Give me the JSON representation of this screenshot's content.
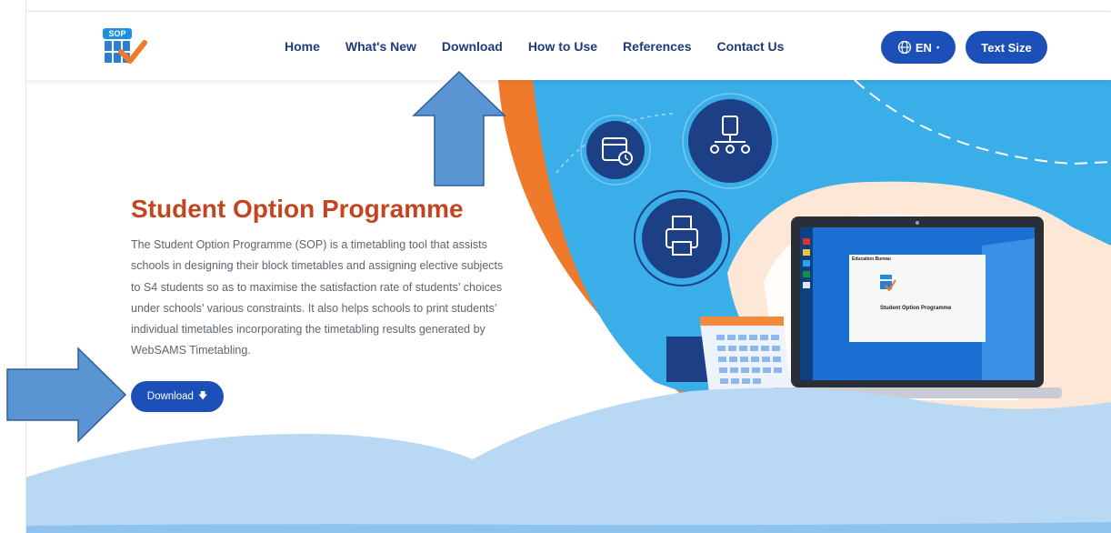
{
  "brand": {
    "logo_tag": "SOP"
  },
  "nav": {
    "items": [
      {
        "label": "Home"
      },
      {
        "label": "What's New"
      },
      {
        "label": "Download"
      },
      {
        "label": "How to Use"
      },
      {
        "label": "References"
      },
      {
        "label": "Contact Us"
      }
    ],
    "lang_label": "EN",
    "text_size_label": "Text Size"
  },
  "hero": {
    "title": "Student Option Programme",
    "description": "The Student Option Programme (SOP) is a timetabling tool that assists schools in designing their block timetables and assigning elective subjects to S4 students so as to maximise the satisfaction rate of students’ choices under schools’ various constraints. It also helps schools to print students’ individual timetables incorporating the timetabling results generated by WebSAMS Timetabling.",
    "download_label": "Download"
  },
  "laptop_screen": {
    "header": "Education Bureau",
    "app_title": "Student Option Programme",
    "logo_tag": "SOP"
  },
  "colors": {
    "nav_text": "#1e3a7a",
    "accent_blue": "#1d4fb8",
    "title_orange": "#c2461f",
    "sky_blue": "#3aaee8",
    "orange_arc": "#f07a2c",
    "wave_blue": "#b8d8f4",
    "annotation_arrow": "#5b94d3"
  }
}
